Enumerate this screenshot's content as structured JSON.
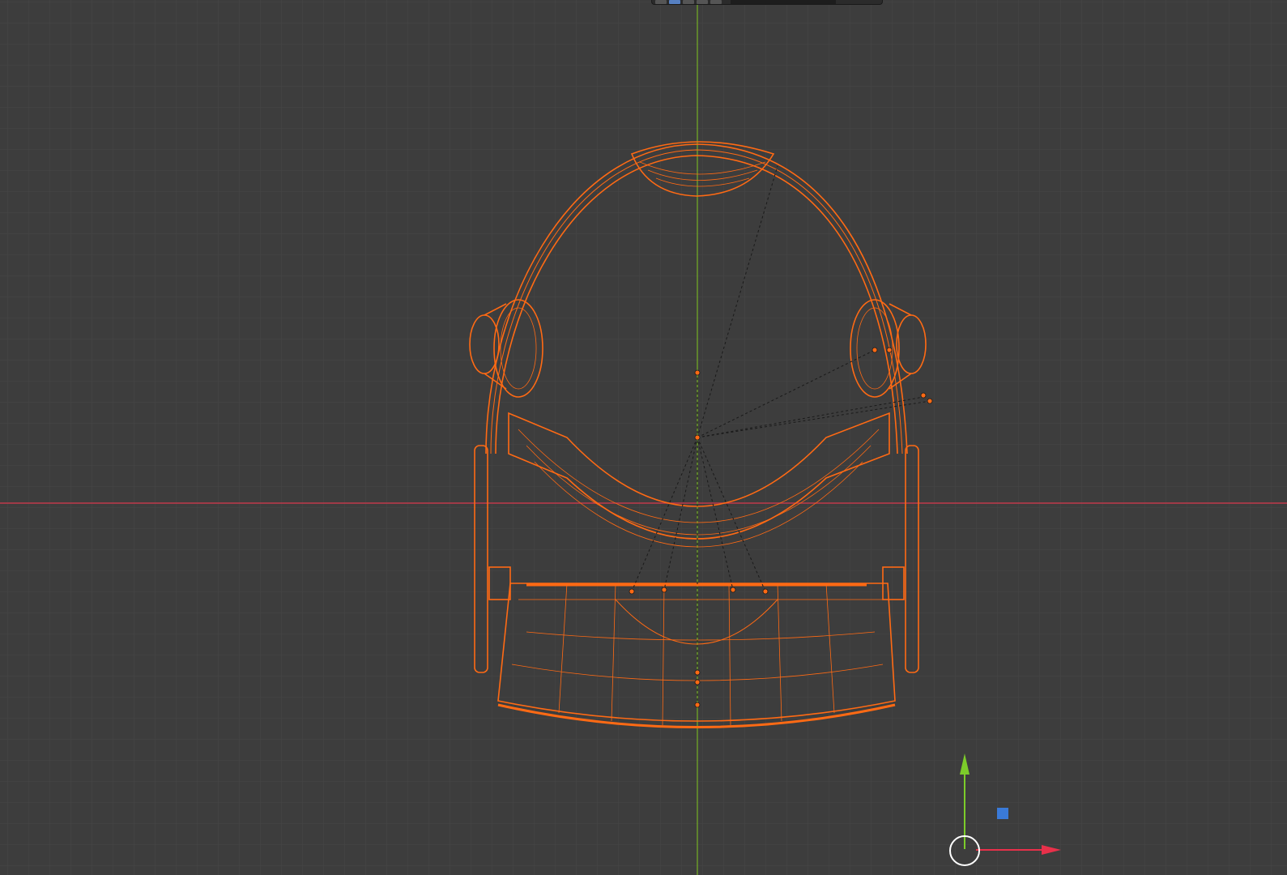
{
  "app": {
    "view": "3D Viewport",
    "shading": "wireframe"
  },
  "colors": {
    "background": "#3d3d3d",
    "grid_minor": "#474747",
    "grid_major": "#4e4e4e",
    "axis_x": "#c0394b",
    "axis_y": "#6a9a2a",
    "selection": "#ff6a14",
    "gizmo_x": "#e8304a",
    "gizmo_y": "#7ccc2a",
    "gizmo_z": "#3a7ad8",
    "gizmo_circle": "#ffffff"
  },
  "icons": {
    "gizmo_x_arrow": "arrow-right-icon",
    "gizmo_y_arrow": "arrow-up-icon",
    "gizmo_z_square": "square-icon",
    "gizmo_origin": "circle-icon"
  },
  "object": {
    "name_semantic": "vr-headset-wireframe",
    "selected": true
  }
}
